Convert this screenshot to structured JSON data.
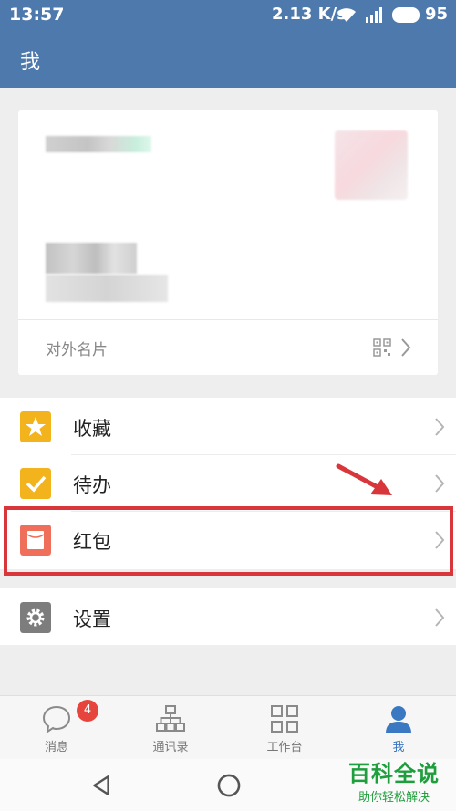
{
  "status_bar": {
    "time": "13:57",
    "speed": "2.13 K/s",
    "battery": "95"
  },
  "header": {
    "title": "我"
  },
  "profile_card": {
    "external_card_label": "对外名片"
  },
  "menu": {
    "items": [
      {
        "label": "收藏",
        "icon": "star-icon",
        "color": "#f2b31c"
      },
      {
        "label": "待办",
        "icon": "check-icon",
        "color": "#f2b31c"
      },
      {
        "label": "红包",
        "icon": "red-envelope-icon",
        "color": "#ef6f5a"
      },
      {
        "label": "设置",
        "icon": "gear-icon",
        "color": "#7d7d7d"
      }
    ]
  },
  "tabbar": {
    "tabs": [
      {
        "label": "消息",
        "icon": "message-icon",
        "badge": "4"
      },
      {
        "label": "通讯录",
        "icon": "org-chart-icon"
      },
      {
        "label": "工作台",
        "icon": "grid-icon"
      },
      {
        "label": "我",
        "icon": "person-icon",
        "active": true
      }
    ]
  },
  "watermark": {
    "line1": "百科全说",
    "line2": "助你轻松解决"
  },
  "colors": {
    "header": "#4e79ad",
    "active_tab": "#3b78c2",
    "highlight": "#d9363b"
  }
}
